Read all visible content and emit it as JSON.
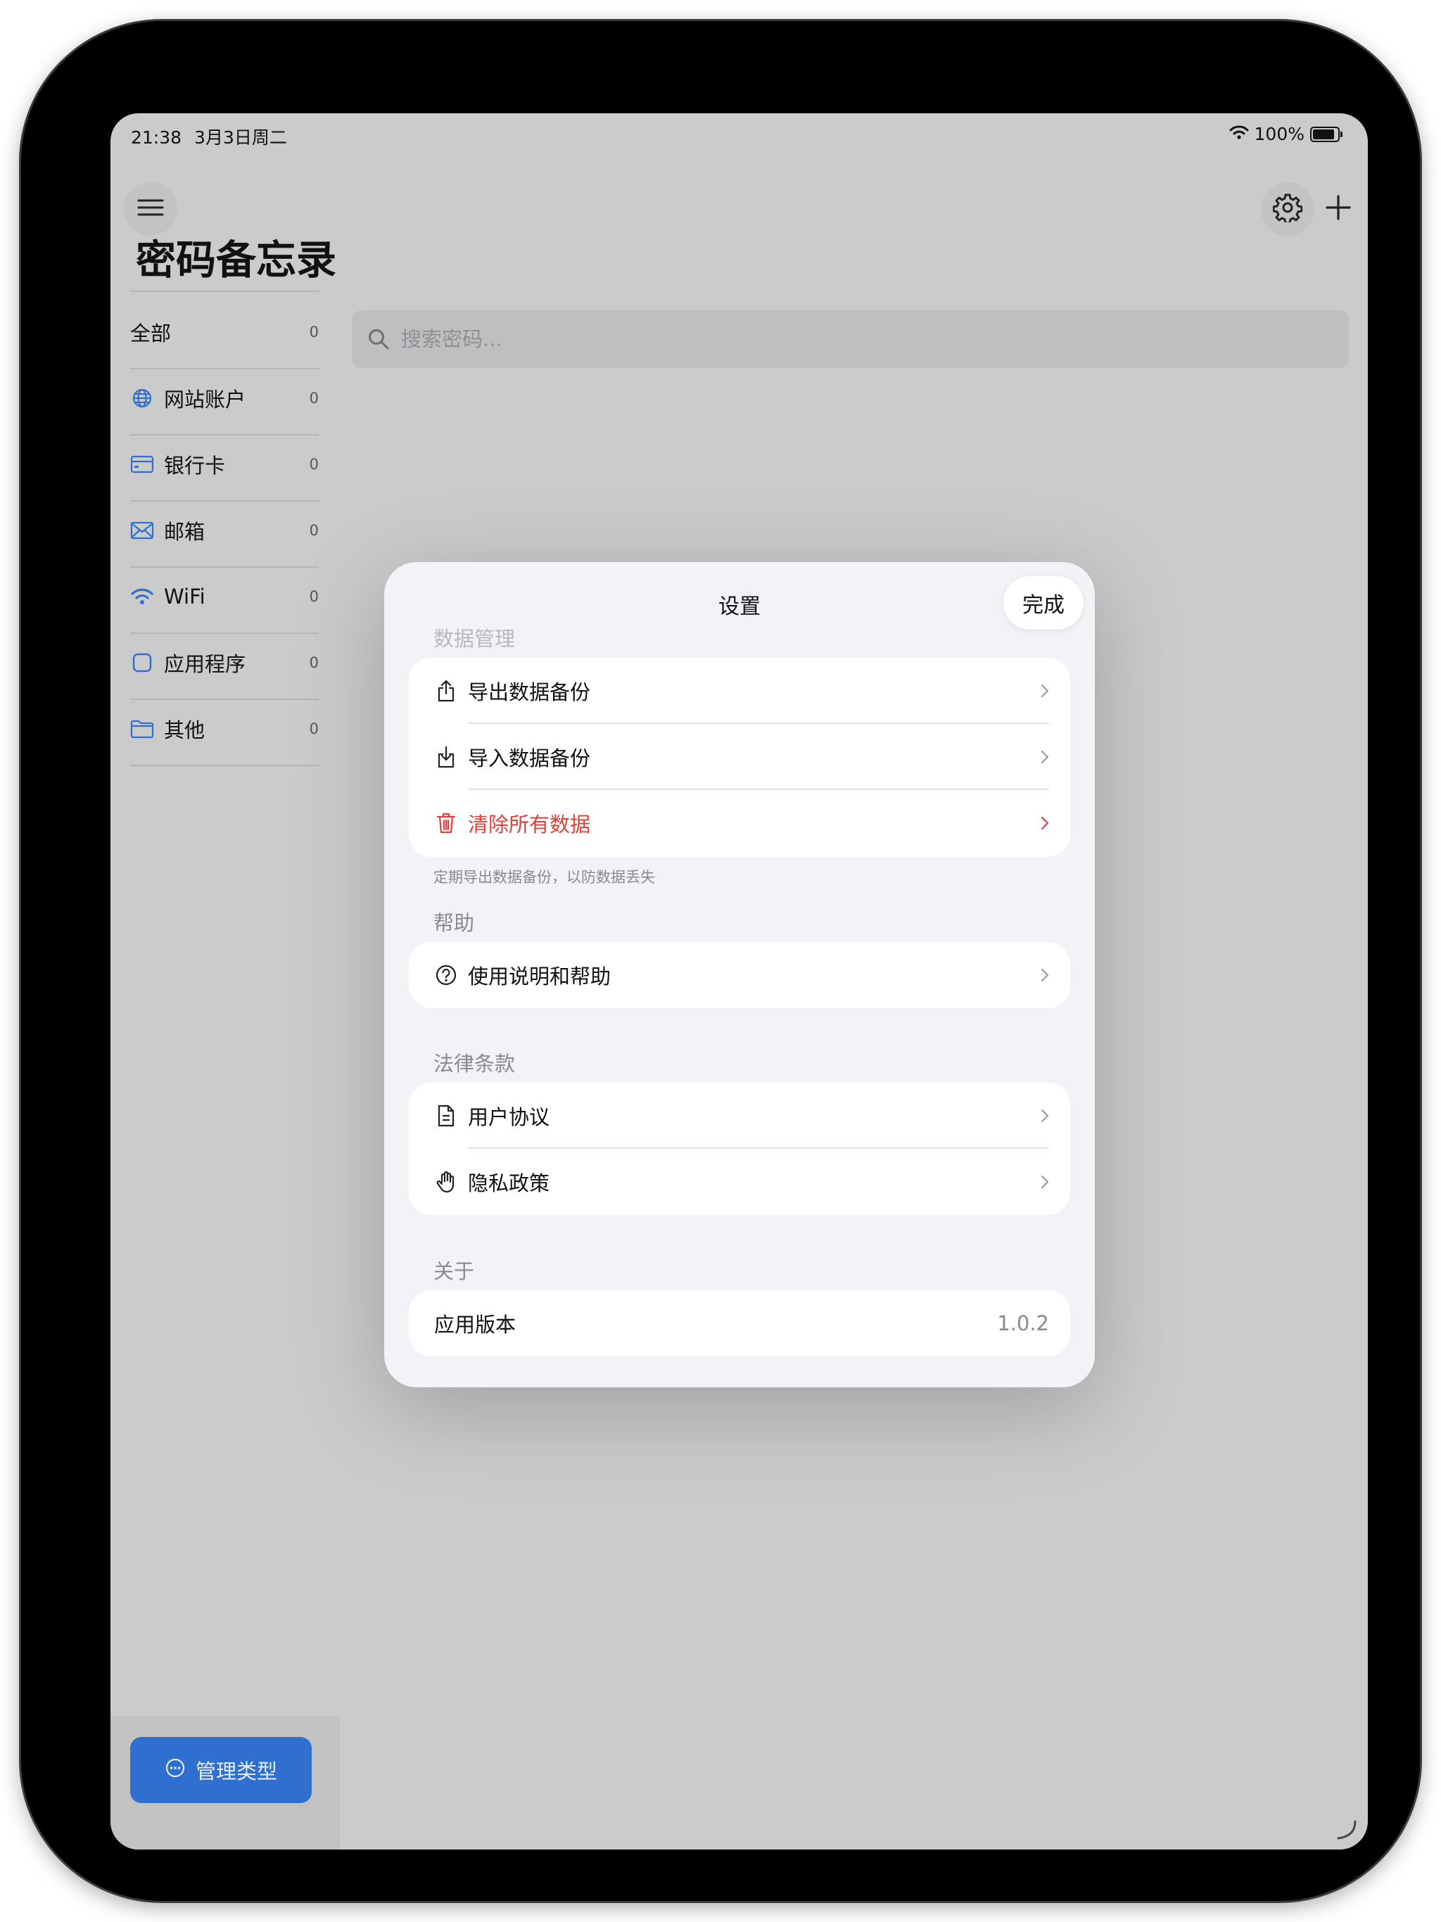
{
  "status_bar": {
    "time": "21:38",
    "date": "3月3日周二",
    "battery": "100%"
  },
  "app": {
    "title": "密码备忘录"
  },
  "sidebar": {
    "items": [
      {
        "label": "全部",
        "count": "0",
        "icon": ""
      },
      {
        "label": "网站账户",
        "count": "0",
        "icon": "globe-icon"
      },
      {
        "label": "银行卡",
        "count": "0",
        "icon": "credit-card-icon"
      },
      {
        "label": "邮箱",
        "count": "0",
        "icon": "envelope-icon"
      },
      {
        "label": "WiFi",
        "count": "0",
        "icon": "wifi-icon"
      },
      {
        "label": "应用程序",
        "count": "0",
        "icon": "app-square-icon"
      },
      {
        "label": "其他",
        "count": "0",
        "icon": "folder-icon"
      }
    ],
    "manage_button": "管理类型"
  },
  "search": {
    "placeholder": "搜索密码..."
  },
  "settings": {
    "title": "设置",
    "done": "完成",
    "sections": {
      "data": {
        "header": "数据管理",
        "export": "导出数据备份",
        "import": "导入数据备份",
        "clear": "清除所有数据",
        "footnote": "定期导出数据备份，以防数据丢失"
      },
      "help": {
        "header": "帮助",
        "guide": "使用说明和帮助"
      },
      "legal": {
        "header": "法律条款",
        "agreement": "用户协议",
        "privacy": "隐私政策"
      },
      "about": {
        "header": "关于",
        "version_label": "应用版本",
        "version_value": "1.0.2"
      }
    }
  },
  "colors": {
    "accent": "#2f6fd0",
    "danger": "#e0403a",
    "sidebar_icon": "#2f6fd0"
  }
}
